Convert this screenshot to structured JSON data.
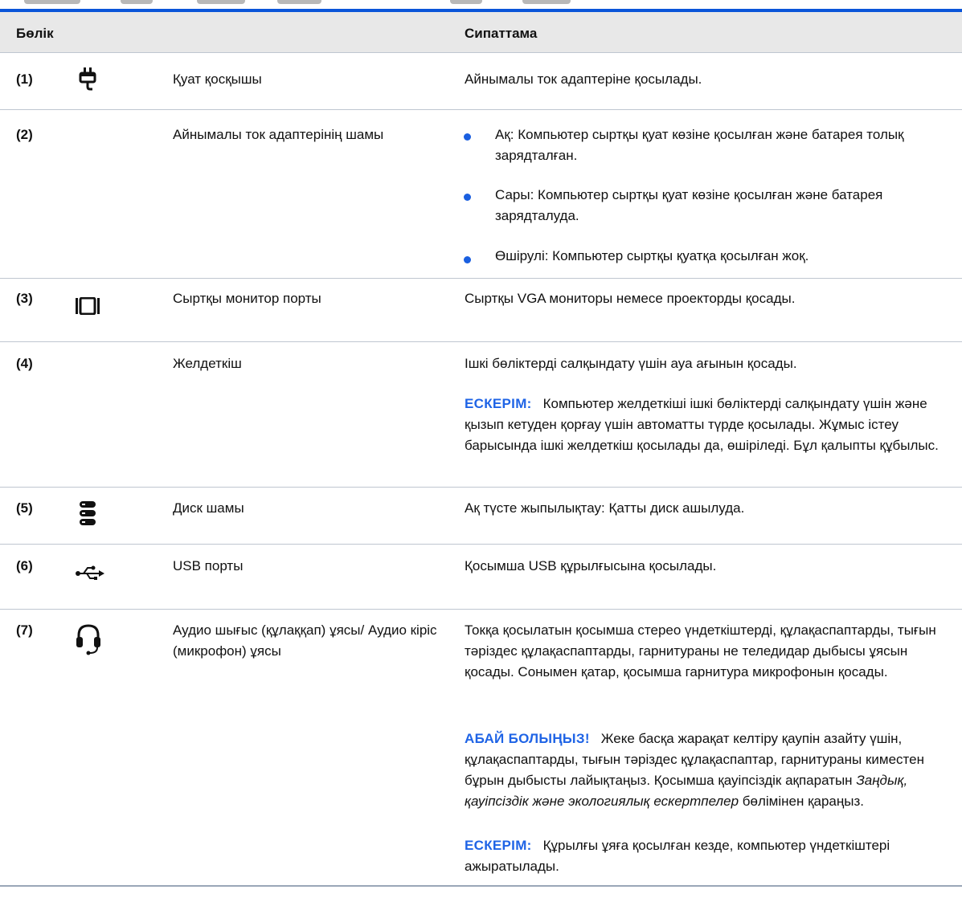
{
  "header": {
    "col_part": "Бөлік",
    "col_desc": "Сипаттама"
  },
  "rows": [
    {
      "num": "(1)",
      "icon": "power-plug-icon",
      "name": "Қуат қосқышы",
      "desc": "Айнымалы ток адаптеріне қосылады."
    },
    {
      "num": "(2)",
      "icon": "",
      "name": "Айнымалы ток адаптерінің шамы",
      "bullets": [
        "Ақ: Компьютер сыртқы қуат көзіне қосылған және батарея толық зарядталған.",
        "Сары: Компьютер сыртқы қуат көзіне қосылған және батарея зарядталуда.",
        "Өшірулі: Компьютер сыртқы қуатқа қосылған жоқ."
      ]
    },
    {
      "num": "(3)",
      "icon": "external-monitor-icon",
      "name": "Сыртқы монитор порты",
      "desc": "Сыртқы VGA мониторы немесе проекторды қосады."
    },
    {
      "num": "(4)",
      "icon": "",
      "name": "Желдеткіш",
      "desc": "Ішкі бөліктерді салқындату үшін ауа ағынын қосады.",
      "note_label": "ЕСКЕРІМ:",
      "note": "Компьютер желдеткіші ішкі бөліктерді салқындату үшін және қызып кетуден қорғау үшін автоматты түрде қосылады. Жұмыс істеу барысында ішкі желдеткіш қосылады да, өшіріледі. Бұл қалыпты құбылыс."
    },
    {
      "num": "(5)",
      "icon": "hard-drive-icon",
      "name": "Диск шамы",
      "desc": "Ақ түсте жыпылықтау: Қатты диск ашылуда."
    },
    {
      "num": "(6)",
      "icon": "usb-icon",
      "name": "USB порты",
      "desc": "Қосымша USB құрылғысына қосылады."
    },
    {
      "num": "(7)",
      "icon": "headset-icon",
      "name": "Аудио шығыс (құлаққап) ұясы/ Аудио кіріс (микрофон) ұясы",
      "desc": "Токқа қосылатын қосымша стерео үндеткіштерді, құлақаспаптарды, тығын тәріздес құлақаспаптарды, гарнитураны не теледидар дыбысы ұясын қосады. Сонымен қатар, қосымша гарнитура микрофонын қосады.",
      "warn_label": "АБАЙ БОЛЫҢЫЗ!",
      "warn_pre": "Жеке басқа жарақат келтіру қаупін азайту үшін, құлақаспаптарды, тығын тәріздес құлақаспаптар, гарнитураны киместен бұрын дыбысты лайықтаңыз. Қосымша қауіпсіздік ақпаратын",
      "warn_italic": "Заңдық, қауіпсіздік және экологиялық ескертпелер",
      "warn_post": "бөлімінен қараңыз.",
      "note_label": "ЕСКЕРІМ:",
      "note": "Құрылғы ұяға қосылған кезде, компьютер үндеткіштері ажыратылады."
    }
  ],
  "colors": {
    "accent": "#1f64e6",
    "rule": "#0a55d9",
    "header_bg": "#e8e8e8",
    "bullet": "#1a5fe0"
  }
}
